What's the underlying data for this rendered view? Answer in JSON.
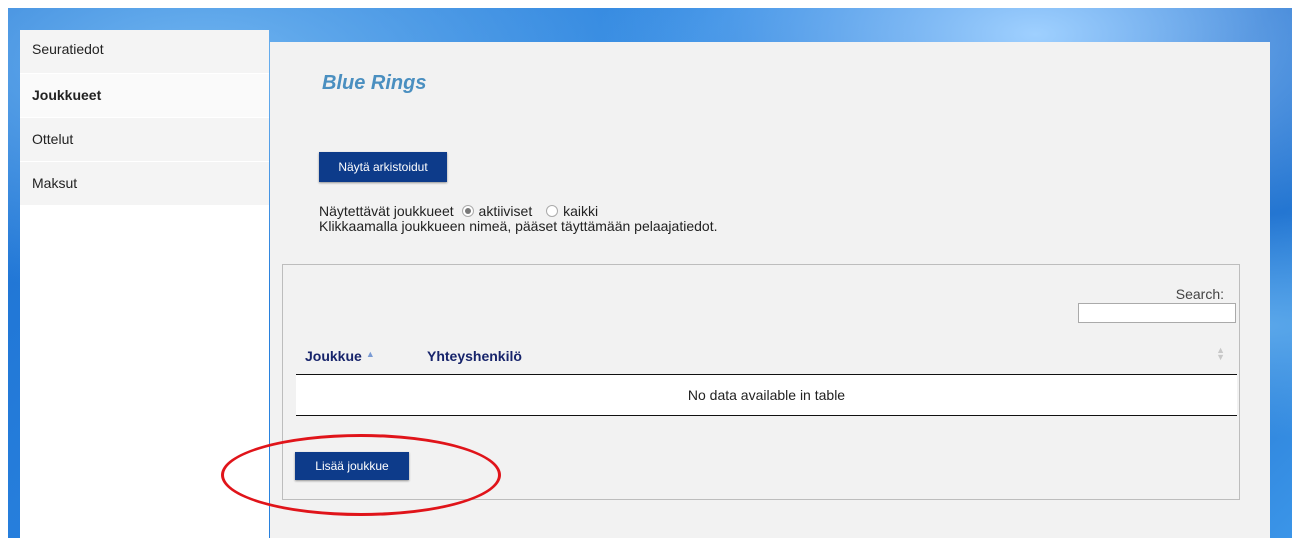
{
  "sidebar": {
    "items": [
      {
        "label": "Seuratiedot"
      },
      {
        "label": "Joukkueet"
      },
      {
        "label": "Ottelut"
      },
      {
        "label": "Maksut"
      }
    ]
  },
  "main": {
    "title": "Blue Rings",
    "archive_button": "Näytä arkistoidut",
    "filter": {
      "label": "Näytettävät joukkueet",
      "options": [
        {
          "label": "aktiiviset",
          "checked": true
        },
        {
          "label": "kaikki",
          "checked": false
        }
      ]
    },
    "hint": "Klikkaamalla joukkueen nimeä, pääset täyttämään pelaajatiedot.",
    "table": {
      "search_label": "Search:",
      "search_value": "",
      "columns": [
        "Joukkue",
        "Yhteyshenkilö"
      ],
      "empty_text": "No data available in table"
    },
    "add_button": "Lisää joukkue"
  },
  "colors": {
    "button": "#0d3b8a",
    "title": "#4a8fc0",
    "header_text": "#17246b",
    "annotation": "#e0141a",
    "background": "#1c6fd0"
  },
  "icons": [
    "sort-ascending-icon",
    "sort-both-icon",
    "radio-checked-icon",
    "radio-unchecked-icon"
  ]
}
